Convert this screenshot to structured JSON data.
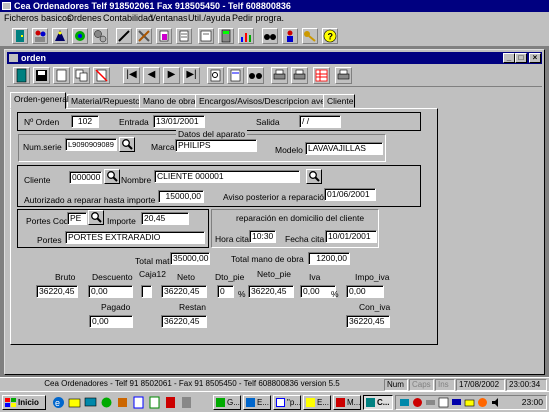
{
  "app": {
    "title": "Cea Ordenadores Telf 918502061 Fax 918505450 - Telf 608800836"
  },
  "menu": [
    {
      "label": "Ficheros basicos"
    },
    {
      "label": "Ordenes"
    },
    {
      "label": "Contabilidad"
    },
    {
      "label": "Ventanas"
    },
    {
      "label": "Util./ayuda"
    },
    {
      "label": "Pedir progra."
    }
  ],
  "app_toolbar_icons": [
    "door-exit-icon",
    "users-icon",
    "wizard-icon",
    "network-icon",
    "gears-icon",
    "pen-icon",
    "tools-icon",
    "notepad-icon",
    "document-icon",
    "report-icon",
    "calculator-icon",
    "chart-icon",
    "binoculars-icon",
    "people-icon",
    "key-icon",
    "help-icon"
  ],
  "child_window": {
    "title": "orden",
    "min_glyph": "_",
    "max_glyph": "□",
    "close_glyph": "×",
    "toolbar_icons": [
      "exit-icon",
      "save-icon",
      "new-icon",
      "copy-icon",
      "delete-icon",
      "first-record-icon",
      "previous-record-icon",
      "next-record-icon",
      "last-record-icon",
      "search-icon",
      "print-preview-icon",
      "find-icon",
      "print-icon",
      "print-icon",
      "grid-icon",
      "print-setup-icon"
    ],
    "nav_glyphs": {
      "first": "|◀",
      "prev": "◀",
      "next": "▶",
      "last": "▶|"
    }
  },
  "tabs": [
    {
      "label": "Orden-general",
      "active": true
    },
    {
      "label": "Material/Repuestos",
      "active": false
    },
    {
      "label": "Mano de obra",
      "active": false
    },
    {
      "label": "Encargos/Avisos/Descripcion averia",
      "active": false
    },
    {
      "label": "Cliente",
      "active": false
    }
  ],
  "form": {
    "orden_label": "Nº Orden",
    "orden_value": "102",
    "entrada_label": "Entrada",
    "entrada_value": "13/01/2001",
    "salida_label": "Salida",
    "salida_value": "/  /",
    "datos_aparato_label": "Datos del aparato",
    "num_serie_label": "Num.serie",
    "num_serie_value": "L9090909089",
    "marca_label": "Marca",
    "marca_value": "PHILIPS",
    "modelo_label": "Modelo",
    "modelo_value": "LAVAVAJILLAS",
    "cliente_label": "Cliente",
    "cliente_value": "0000001",
    "nombre_label": "Nombre",
    "nombre_value": "CLIENTE 000001",
    "autorizado_label": "Autorizado a reparar hasta importe",
    "autorizado_value": "15000,00",
    "aviso_label": "Aviso posterior a reparación",
    "aviso_value": "01/06/2001",
    "portes_cod_label": "Portes Cod",
    "portes_cod_value": "PE",
    "importe_label": "Importe",
    "importe_value": "20,45",
    "portes_label": "Portes",
    "portes_value": "PORTES EXTRARADIO",
    "domicilio_label": "reparación en domicilio del cliente",
    "hora_cita_label": "Hora cita",
    "hora_cita_value": "10:30",
    "fecha_cita_label": "Fecha cita",
    "fecha_cita_value": "10/01/2001",
    "total_materiales_label": "Total materiales",
    "total_materiales_value": "35000,00",
    "total_mano_obra_label": "Total mano de obra",
    "total_mano_obra_value": "1200,00"
  },
  "totals": {
    "bruto_label": "Bruto",
    "bruto_value": "36220,45",
    "descuento_label": "Descuento",
    "descuento_value": "0,00",
    "caja12_label": "Caja12",
    "caja12_value": "",
    "neto_label": "Neto",
    "neto_value": "36220,45",
    "dto_pie_label": "Dto_pie",
    "dto_pie_value": "0",
    "pct1": "%",
    "neto_pie_label": "Neto_pie",
    "neto_pie_value": "36220,45",
    "iva_label": "Iva",
    "iva_value": "0,00",
    "pct2": "%",
    "impo_iva_label": "Impo_iva",
    "impo_iva_value": "0,00",
    "pagado_label": "Pagado",
    "pagado_value": "0,00",
    "restan_label": "Restan",
    "restan_value": "36220,45",
    "con_iva_label": "Con_iva",
    "con_iva_value": "36220,45"
  },
  "statusbar": {
    "message": "Cea Ordenadores - Telf 91 8502061 - Fax 91 8505450 - Telf 608800836 version 5.5",
    "num": "Num",
    "caps": "Caps",
    "ins": "Ins",
    "date": "17/08/2002",
    "time": "23:00:34"
  },
  "taskbar": {
    "start_label": "Inicio",
    "items": [
      {
        "label": "G..."
      },
      {
        "label": "E..."
      },
      {
        "label": "\"p..."
      },
      {
        "label": "E..."
      },
      {
        "label": "M..."
      },
      {
        "label": "C..."
      }
    ],
    "clock": "23:00"
  }
}
